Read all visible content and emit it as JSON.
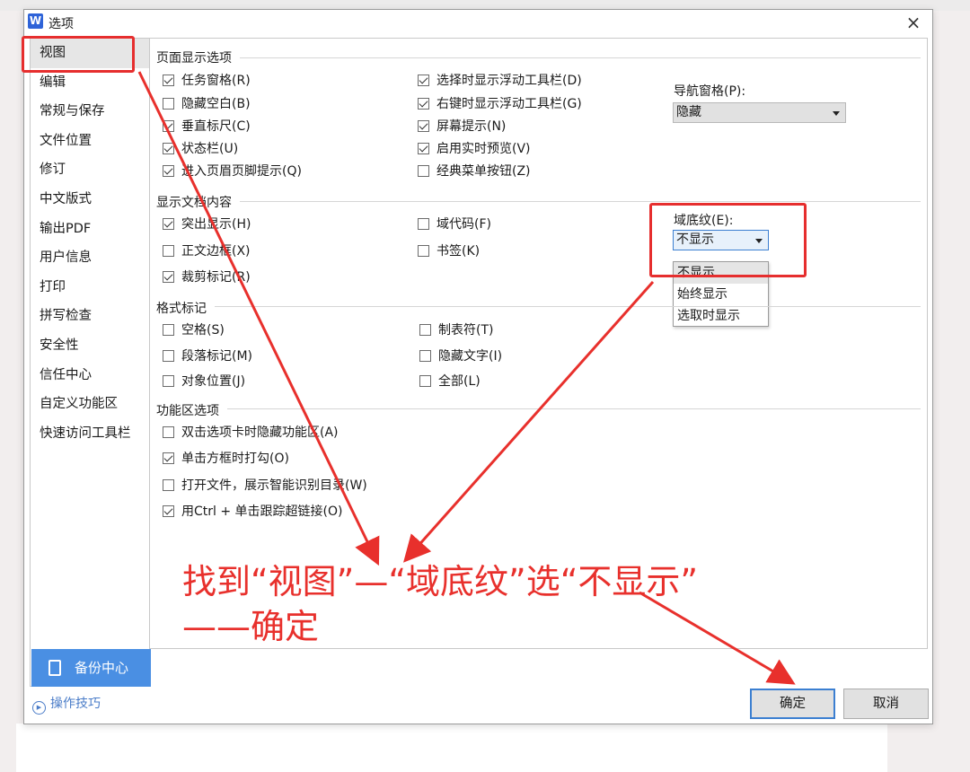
{
  "window": {
    "logo": "W",
    "title": "选项",
    "close_glyph": "×"
  },
  "sidebar": {
    "items": [
      {
        "label": "视图",
        "active": true
      },
      {
        "label": "编辑"
      },
      {
        "label": "常规与保存"
      },
      {
        "label": "文件位置"
      },
      {
        "label": "修订"
      },
      {
        "label": "中文版式"
      },
      {
        "label": "输出PDF"
      },
      {
        "label": "用户信息"
      },
      {
        "label": "打印"
      },
      {
        "label": "拼写检查"
      },
      {
        "label": "安全性"
      },
      {
        "label": "信任中心"
      },
      {
        "label": "自定义功能区"
      },
      {
        "label": "快速访问工具栏"
      }
    ],
    "backup_label": "备份中心",
    "tips_label": "操作技巧"
  },
  "page_display": {
    "title": "页面显示选项",
    "col1": [
      {
        "label": "任务窗格(R)",
        "checked": true
      },
      {
        "label": "隐藏空白(B)",
        "checked": false
      },
      {
        "label": "垂直标尺(C)",
        "checked": true
      },
      {
        "label": "状态栏(U)",
        "checked": true
      },
      {
        "label": "进入页眉页脚提示(Q)",
        "checked": true
      }
    ],
    "col2": [
      {
        "label": "选择时显示浮动工具栏(D)",
        "checked": true
      },
      {
        "label": "右键时显示浮动工具栏(G)",
        "checked": true
      },
      {
        "label": "屏幕提示(N)",
        "checked": true
      },
      {
        "label": "启用实时预览(V)",
        "checked": true
      },
      {
        "label": "经典菜单按钮(Z)",
        "checked": false
      }
    ],
    "nav_pane_label": "导航窗格(P):",
    "nav_pane_value": "隐藏"
  },
  "doc_content": {
    "title": "显示文档内容",
    "col1": [
      {
        "label": "突出显示(H)",
        "checked": true
      },
      {
        "label": "正文边框(X)",
        "checked": false
      },
      {
        "label": "裁剪标记(R)",
        "checked": true
      }
    ],
    "col2": [
      {
        "label": "域代码(F)",
        "checked": false
      },
      {
        "label": "书签(K)",
        "checked": false
      }
    ],
    "field_shading_label": "域底纹(E):",
    "field_shading_value": "不显示",
    "field_shading_options": [
      "不显示",
      "始终显示",
      "选取时显示"
    ]
  },
  "format_marks": {
    "title": "格式标记",
    "col1": [
      {
        "label": "空格(S)",
        "checked": false
      },
      {
        "label": "段落标记(M)",
        "checked": false
      },
      {
        "label": "对象位置(J)",
        "checked": false
      }
    ],
    "col2": [
      {
        "label": "制表符(T)",
        "checked": false
      },
      {
        "label": "隐藏文字(I)",
        "checked": false
      },
      {
        "label": "全部(L)",
        "checked": false
      }
    ]
  },
  "ribbon": {
    "title": "功能区选项",
    "items": [
      {
        "label": "双击选项卡时隐藏功能区(A)",
        "checked": false
      },
      {
        "label": "单击方框时打勾(O)",
        "checked": true
      },
      {
        "label": "打开文件，展示智能识别目录(W)",
        "checked": false
      },
      {
        "label": "用Ctrl + 单击跟踪超链接(O)",
        "checked": true
      }
    ]
  },
  "buttons": {
    "ok": "确定",
    "cancel": "取消"
  },
  "annotation": {
    "line1": "找到“视图”—“域底纹”选“不显示”",
    "line2": "——确定",
    "color": "#e8302c"
  }
}
